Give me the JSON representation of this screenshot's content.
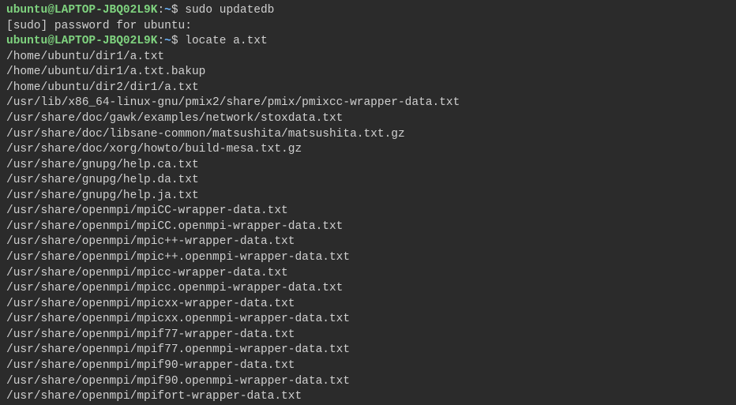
{
  "prompt": {
    "user_host": "ubuntu@LAPTOP-JBQ02L9K",
    "separator": ":",
    "path": "~",
    "dollar": "$"
  },
  "commands": {
    "cmd1": "sudo updatedb",
    "cmd2": "locate a.txt"
  },
  "sudo_prompt": "[sudo] password for ubuntu:",
  "output_lines": [
    "/home/ubuntu/dir1/a.txt",
    "/home/ubuntu/dir1/a.txt.bakup",
    "/home/ubuntu/dir2/dir1/a.txt",
    "/usr/lib/x86_64-linux-gnu/pmix2/share/pmix/pmixcc-wrapper-data.txt",
    "/usr/share/doc/gawk/examples/network/stoxdata.txt",
    "/usr/share/doc/libsane-common/matsushita/matsushita.txt.gz",
    "/usr/share/doc/xorg/howto/build-mesa.txt.gz",
    "/usr/share/gnupg/help.ca.txt",
    "/usr/share/gnupg/help.da.txt",
    "/usr/share/gnupg/help.ja.txt",
    "/usr/share/openmpi/mpiCC-wrapper-data.txt",
    "/usr/share/openmpi/mpiCC.openmpi-wrapper-data.txt",
    "/usr/share/openmpi/mpic++-wrapper-data.txt",
    "/usr/share/openmpi/mpic++.openmpi-wrapper-data.txt",
    "/usr/share/openmpi/mpicc-wrapper-data.txt",
    "/usr/share/openmpi/mpicc.openmpi-wrapper-data.txt",
    "/usr/share/openmpi/mpicxx-wrapper-data.txt",
    "/usr/share/openmpi/mpicxx.openmpi-wrapper-data.txt",
    "/usr/share/openmpi/mpif77-wrapper-data.txt",
    "/usr/share/openmpi/mpif77.openmpi-wrapper-data.txt",
    "/usr/share/openmpi/mpif90-wrapper-data.txt",
    "/usr/share/openmpi/mpif90.openmpi-wrapper-data.txt",
    "/usr/share/openmpi/mpifort-wrapper-data.txt"
  ]
}
